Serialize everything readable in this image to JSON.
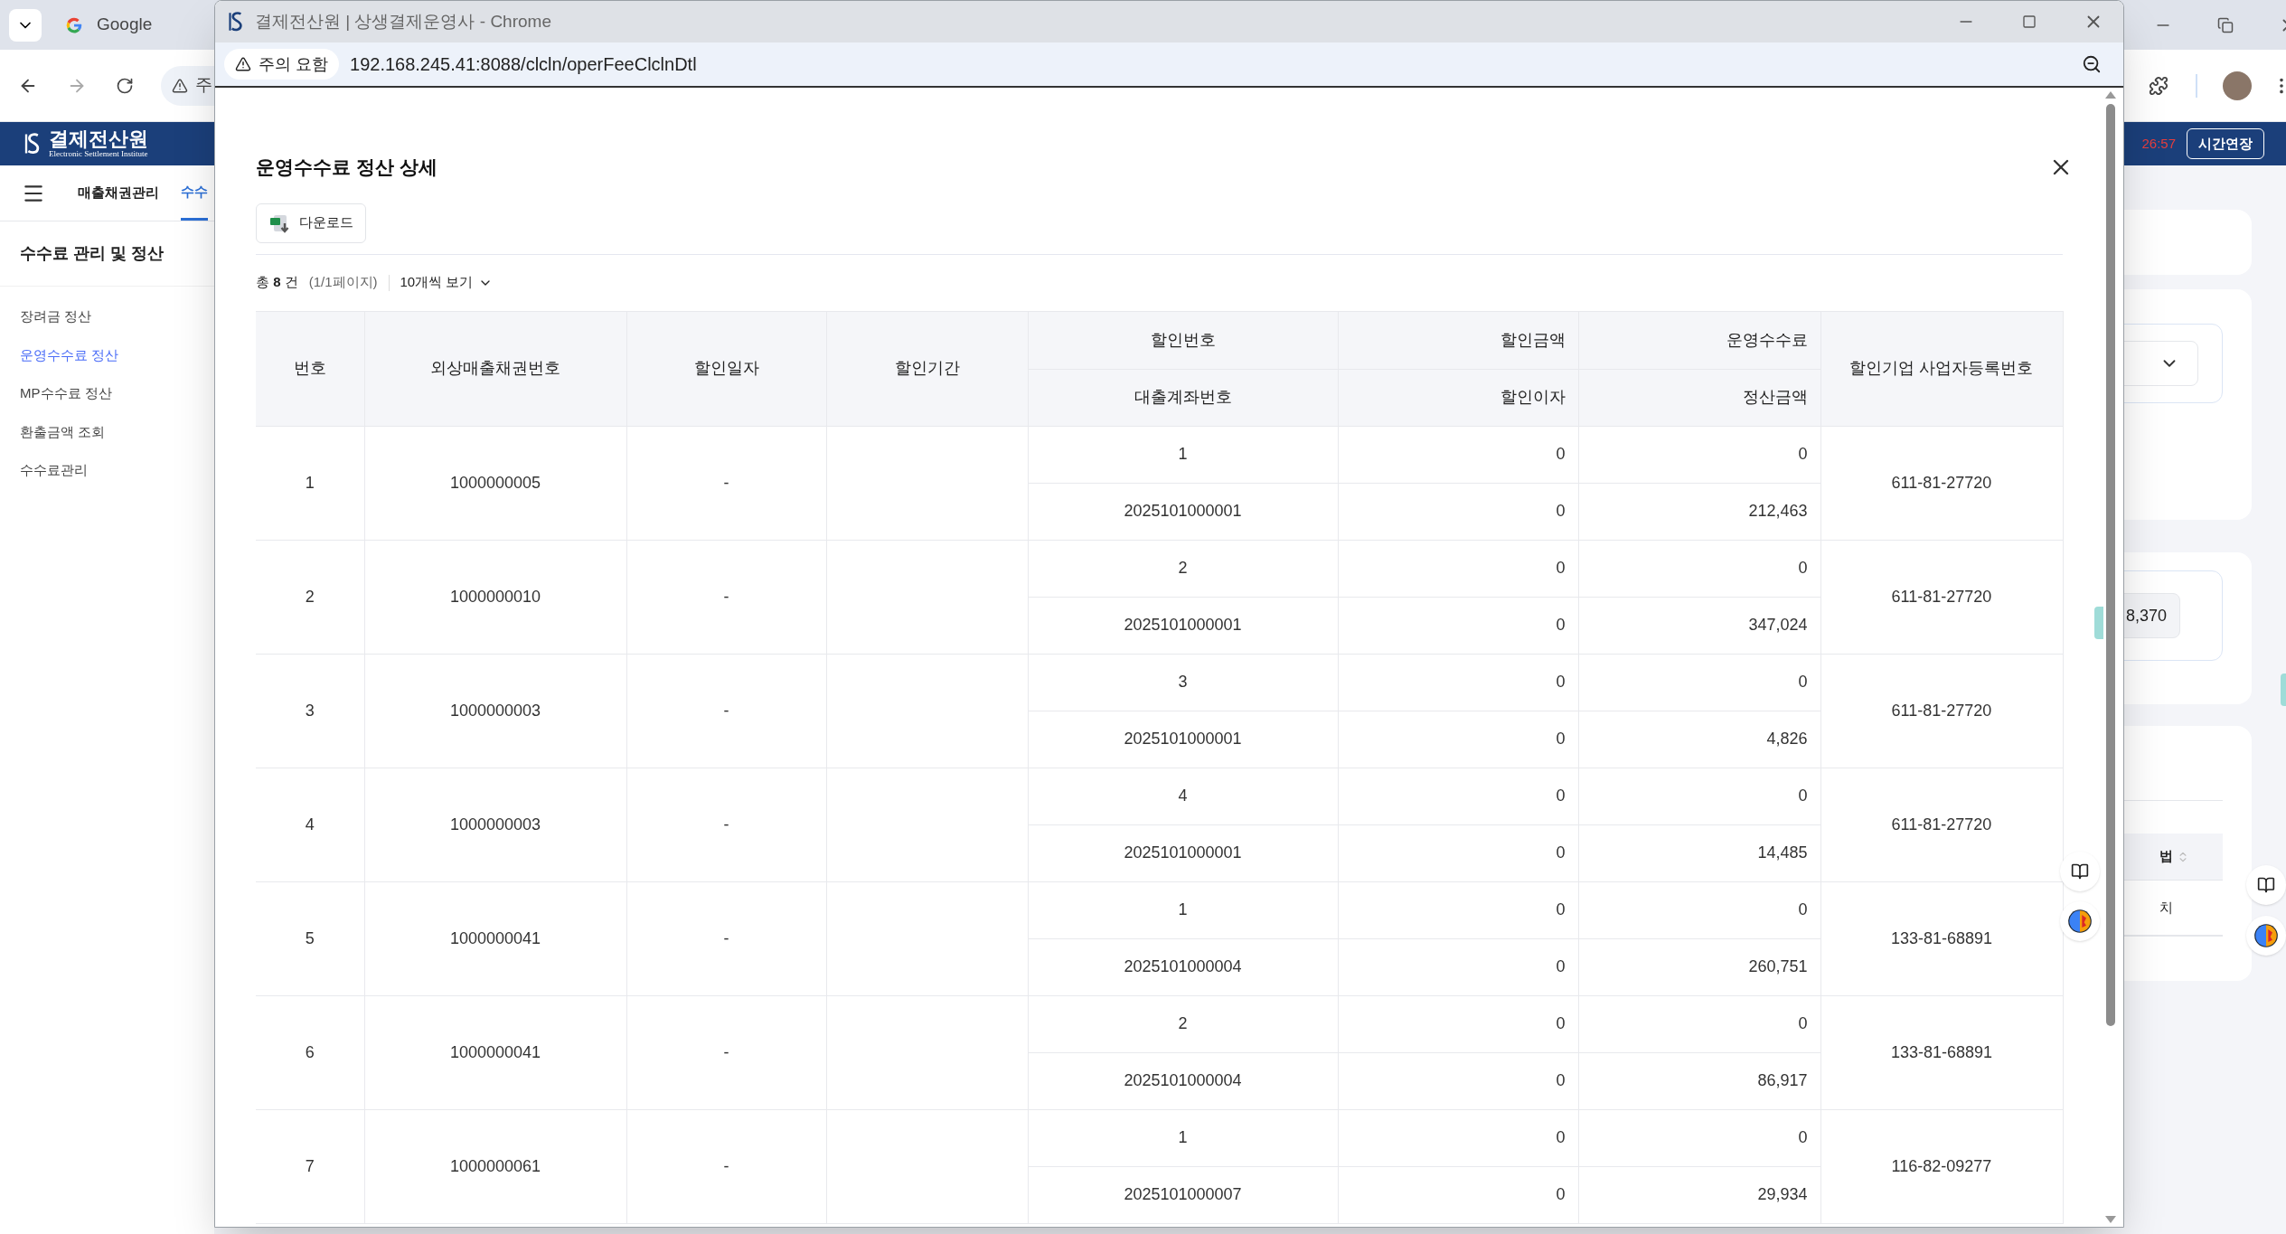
{
  "browser": {
    "tab_title": "Google",
    "omnibox_text": "주"
  },
  "page": {
    "logo": {
      "name": "결제전산원",
      "tagline": "Electronic Settlement Institute"
    },
    "session_timer": "26:57",
    "extend_button": "시간연장",
    "nav_items": [
      {
        "label": "매출채권관리",
        "selected": false
      },
      {
        "label": "수수",
        "selected": true
      }
    ],
    "sidebar": {
      "title": "수수료 관리 및 정산",
      "items": [
        {
          "label": "장려금 정산",
          "selected": false
        },
        {
          "label": "운영수수료 정산",
          "selected": true
        },
        {
          "label": "MP수수료 정산",
          "selected": false
        },
        {
          "label": "환출금액 조회",
          "selected": false
        },
        {
          "label": "수수료관리",
          "selected": false
        }
      ]
    },
    "right_fragments": {
      "amount": "8,370",
      "column_header": "법",
      "cell": "치"
    }
  },
  "popup": {
    "window_title": "결제전산원 | 상생결제운영사 - Chrome",
    "security_label": "주의 요함",
    "url": "192.168.245.41:8088/clcln/operFeeClclnDtl",
    "title": "운영수수료 정산 상세",
    "download_button": "다운로드",
    "summary": "총 **8** 건",
    "page_info": "(1/1페이지)",
    "page_size": "10개씩 보기",
    "table": {
      "columns": [
        {
          "label": "번호"
        },
        {
          "label": "외상매출채권번호"
        },
        {
          "label": "할인일자"
        },
        {
          "label": "할인기간"
        },
        {
          "label": "할인번호",
          "sub_label": "대출계좌번호"
        },
        {
          "label": "할인금액",
          "sub_label": "할인이자"
        },
        {
          "label": "운영수수료",
          "sub_label": "정산금액"
        },
        {
          "label": "할인기업 사업자등록번호"
        }
      ],
      "rows": [
        {
          "no": "1",
          "receivable_no": "1000000005",
          "discount_date": "-",
          "discount_no": "1",
          "loan_account": "2025101000001",
          "discount_amount": "0",
          "discount_interest": "0",
          "operating_fee": "0",
          "settlement_amount": "212,463",
          "business_reg_no": "611-81-27720"
        },
        {
          "no": "2",
          "receivable_no": "1000000010",
          "discount_date": "-",
          "discount_no": "2",
          "loan_account": "2025101000001",
          "discount_amount": "0",
          "discount_interest": "0",
          "operating_fee": "0",
          "settlement_amount": "347,024",
          "business_reg_no": "611-81-27720"
        },
        {
          "no": "3",
          "receivable_no": "1000000003",
          "discount_date": "-",
          "discount_no": "3",
          "loan_account": "2025101000001",
          "discount_amount": "0",
          "discount_interest": "0",
          "operating_fee": "0",
          "settlement_amount": "4,826",
          "business_reg_no": "611-81-27720"
        },
        {
          "no": "4",
          "receivable_no": "1000000003",
          "discount_date": "-",
          "discount_no": "4",
          "loan_account": "2025101000001",
          "discount_amount": "0",
          "discount_interest": "0",
          "operating_fee": "0",
          "settlement_amount": "14,485",
          "business_reg_no": "611-81-27720"
        },
        {
          "no": "5",
          "receivable_no": "1000000041",
          "discount_date": "-",
          "discount_no": "1",
          "loan_account": "2025101000004",
          "discount_amount": "0",
          "discount_interest": "0",
          "operating_fee": "0",
          "settlement_amount": "260,751",
          "business_reg_no": "133-81-68891"
        },
        {
          "no": "6",
          "receivable_no": "1000000041",
          "discount_date": "-",
          "discount_no": "2",
          "loan_account": "2025101000004",
          "discount_amount": "0",
          "discount_interest": "0",
          "operating_fee": "0",
          "settlement_amount": "86,917",
          "business_reg_no": "133-81-68891"
        },
        {
          "no": "7",
          "receivable_no": "1000000061",
          "discount_date": "-",
          "discount_no": "1",
          "loan_account": "2025101000007",
          "discount_amount": "0",
          "discount_interest": "0",
          "operating_fee": "0",
          "settlement_amount": "29,934",
          "business_reg_no": "116-82-09277"
        }
      ]
    }
  }
}
